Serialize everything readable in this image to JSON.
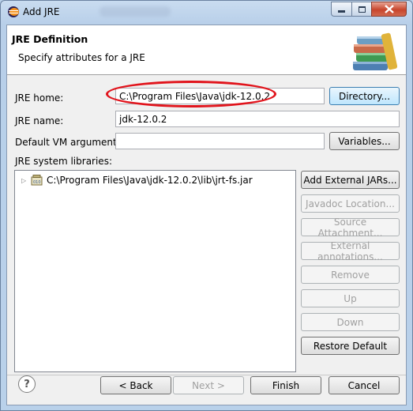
{
  "window": {
    "title": "Add JRE",
    "controls": {
      "minimize_icon": "minimize-icon",
      "maximize_icon": "maximize-icon",
      "close_icon": "close-icon"
    }
  },
  "banner": {
    "title": "JRE Definition",
    "subtitle": "Specify attributes for a JRE",
    "icon": "books-icon"
  },
  "form": {
    "jre_home_label": "JRE home:",
    "jre_home_value": "C:\\Program Files\\Java\\jdk-12.0.2",
    "directory_button": "Directory...",
    "jre_name_label": "JRE name:",
    "jre_name_value": "jdk-12.0.2",
    "vm_args_label": "Default VM arguments:",
    "vm_args_value": "",
    "variables_button": "Variables...",
    "libraries_label": "JRE system libraries:"
  },
  "libraries": [
    {
      "path": "C:\\Program Files\\Java\\jdk-12.0.2\\lib\\jrt-fs.jar",
      "icon": "jar-icon",
      "collapsed": true
    }
  ],
  "library_buttons": {
    "add_external_jars": "Add External JARs...",
    "javadoc_location": "Javadoc Location...",
    "source_attachment": "Source Attachment...",
    "external_annotations": "External annotations...",
    "remove": "Remove",
    "up": "Up",
    "down": "Down",
    "restore_default": "Restore Default"
  },
  "footer": {
    "help_icon": "help-icon",
    "help_glyph": "?",
    "back": "< Back",
    "next": "Next >",
    "finish": "Finish",
    "cancel": "Cancel"
  },
  "colors": {
    "highlight_ellipse": "#e1141c",
    "dialog_background": "#f0f0f0",
    "focus_button": "#3c7fb1"
  }
}
